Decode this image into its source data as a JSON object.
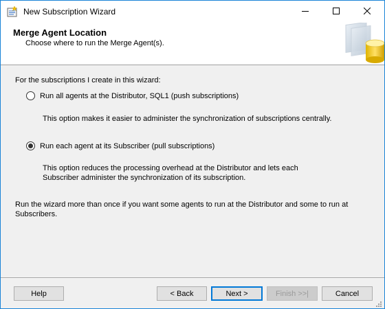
{
  "window": {
    "title": "New Subscription Wizard",
    "icon": "wizard-app-icon"
  },
  "header": {
    "title": "Merge Agent Location",
    "subtitle": "Choose where to run the Merge Agent(s).",
    "graphic": "database-graphic"
  },
  "body": {
    "intro": "For the subscriptions I create in this wizard:",
    "options": [
      {
        "label": "Run all agents at the Distributor, SQL1 (push subscriptions)",
        "description": "This option makes it easier to administer the synchronization of subscriptions centrally.",
        "selected": false
      },
      {
        "label": "Run each agent at its Subscriber (pull subscriptions)",
        "description": "This option reduces the processing overhead at the Distributor and lets each Subscriber administer the synchronization of its subscription.",
        "selected": true
      }
    ],
    "note": "Run the wizard more than once if you want some agents to run at the Distributor and some to run at Subscribers."
  },
  "buttons": {
    "help": "Help",
    "back": "< Back",
    "next": "Next >",
    "finish": "Finish >>|",
    "cancel": "Cancel"
  },
  "colors": {
    "window_border": "#1883d7",
    "default_button_border": "#0078d7",
    "dialog_background": "#f0f0f0"
  }
}
